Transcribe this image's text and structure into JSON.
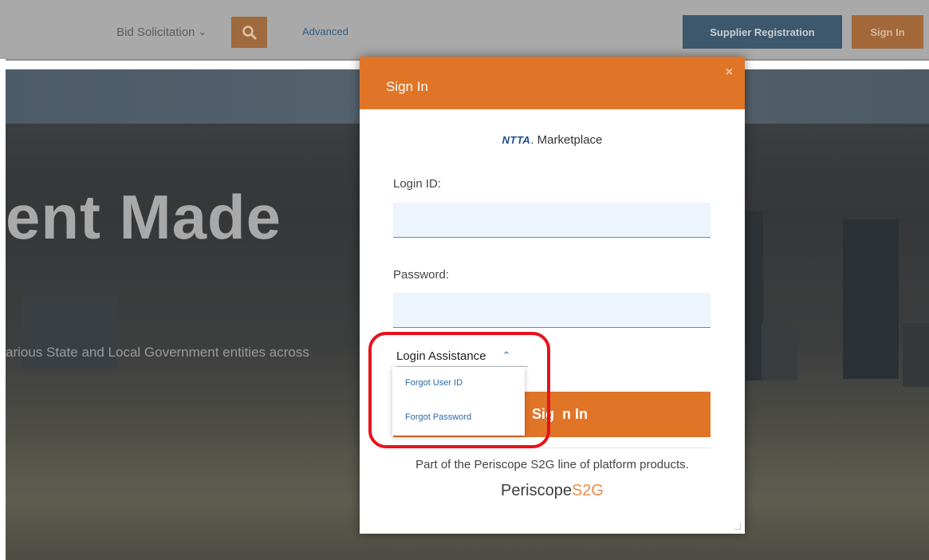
{
  "topbar": {
    "bid_select": "Bid Solicitation",
    "advanced_label": "Advanced",
    "supplier_registration": "Supplier Registration",
    "sign_in": "Sign In"
  },
  "hero": {
    "title": "ent Made",
    "subtitle": "arious State and Local Government entities across"
  },
  "modal": {
    "title": "Sign In",
    "close": "×",
    "brand_prefix": "NTTA",
    "brand_suffix": "Marketplace",
    "login_id_label": "Login ID:",
    "login_id_value": "",
    "password_label": "Password:",
    "password_value": "",
    "login_assistance": "Login Assistance",
    "assistance_options": [
      "Forgot User ID",
      "Forgot Password"
    ],
    "sign_in_button": "Sign In",
    "sign_in_button_visible": "Sig",
    "sign_in_button_visible_rest": "n In",
    "footer_text": "Part of the Periscope S2G line of platform products.",
    "logo_text_1": "Periscope",
    "logo_text_2": "S2G"
  },
  "colors": {
    "accent_orange": "#e07427",
    "link_blue": "#2e6aa6",
    "annotation_red": "#e8121b"
  }
}
